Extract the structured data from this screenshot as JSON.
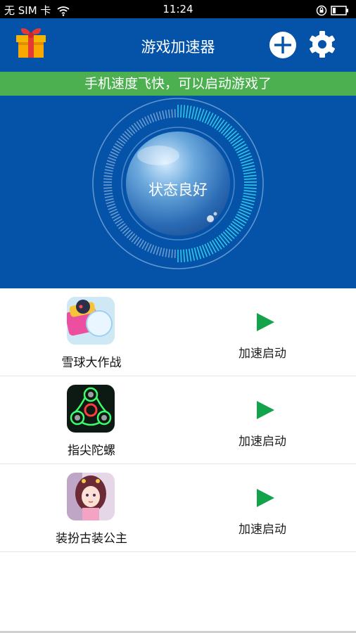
{
  "status_bar": {
    "carrier": "无 SIM 卡",
    "time": "11:24"
  },
  "app_bar": {
    "title": "游戏加速器"
  },
  "banner": {
    "text": "手机速度飞快，可以启动游戏了"
  },
  "hero": {
    "status": "状态良好"
  },
  "games": [
    {
      "name": "雪球大作战",
      "action": "加速启动",
      "icon": "snowball-game-icon"
    },
    {
      "name": "指尖陀螺",
      "action": "加速启动",
      "icon": "fidget-spinner-icon"
    },
    {
      "name": "装扮古装公主",
      "action": "加速启动",
      "icon": "princess-dressup-icon"
    }
  ],
  "colors": {
    "primary": "#0553a9",
    "banner": "#4caf50",
    "play": "#13a34a",
    "gauge": "#2ec7e6"
  }
}
